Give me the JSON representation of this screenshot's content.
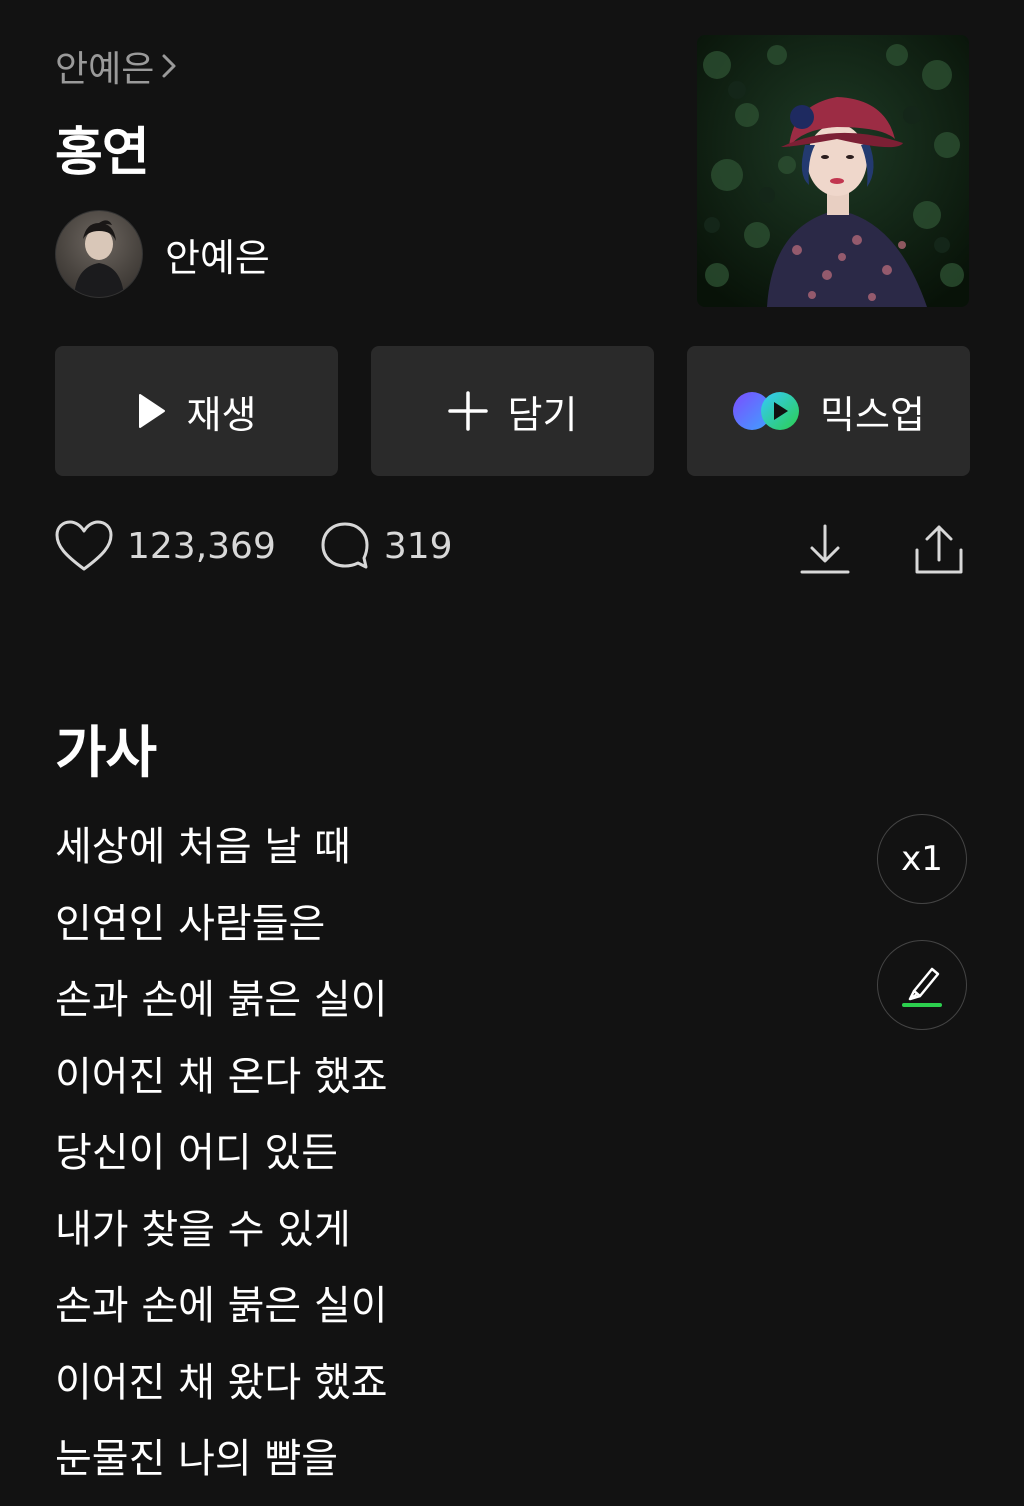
{
  "header": {
    "breadcrumb_artist": "안예은",
    "song_title": "홍연",
    "artist_name": "안예은"
  },
  "actions": {
    "play_label": "재생",
    "add_label": "담기",
    "mixup_label": "믹스업"
  },
  "stats": {
    "likes": "123,369",
    "comments": "319"
  },
  "lyrics": {
    "heading": "가사",
    "lines": [
      "세상에 처음 날 때",
      "인연인 사람들은",
      "손과 손에 붉은 실이",
      "이어진 채 온다 했죠",
      "당신이 어디 있든",
      "내가 찾을 수 있게",
      "손과 손에 붉은 실이",
      "이어진 채 왔다 했죠",
      "눈물진 나의 뺨을"
    ],
    "speed_label": "x1"
  },
  "icons": {
    "breadcrumb": "chevron-right-icon",
    "play": "play-icon",
    "add": "plus-icon",
    "mixup": "mixup-icon",
    "like": "heart-icon",
    "comment": "comment-icon",
    "download": "download-icon",
    "share": "share-icon",
    "highlight": "highlighter-icon"
  },
  "colors": {
    "background": "#121212",
    "button_bg": "#2a2a2a",
    "accent_green": "#2ccf4e",
    "mixup_purple": "#7b4dff",
    "mixup_blue": "#3fa2ff"
  }
}
